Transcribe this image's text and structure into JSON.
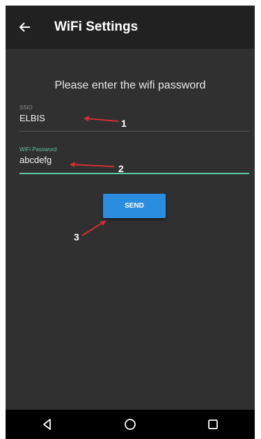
{
  "appbar": {
    "title": "WiFi Settings",
    "back_icon": "arrow-left-icon"
  },
  "form": {
    "prompt": "Please enter the wifi password",
    "ssid_label": "SSID",
    "ssid_value": "ELBIS",
    "password_label": "WiFi Password",
    "password_value": "abcdefg",
    "send_label": "SEND"
  },
  "annotations": {
    "one": "1",
    "two": "2",
    "three": "3",
    "arrow_color": "#d32f2f"
  },
  "navbar": {
    "back_icon": "triangle-back-icon",
    "home_icon": "circle-home-icon",
    "recents_icon": "square-recents-icon"
  },
  "colors": {
    "background": "#303030",
    "appbar": "#212121",
    "accent": "#5fc2a4",
    "button": "#2b8de0"
  }
}
